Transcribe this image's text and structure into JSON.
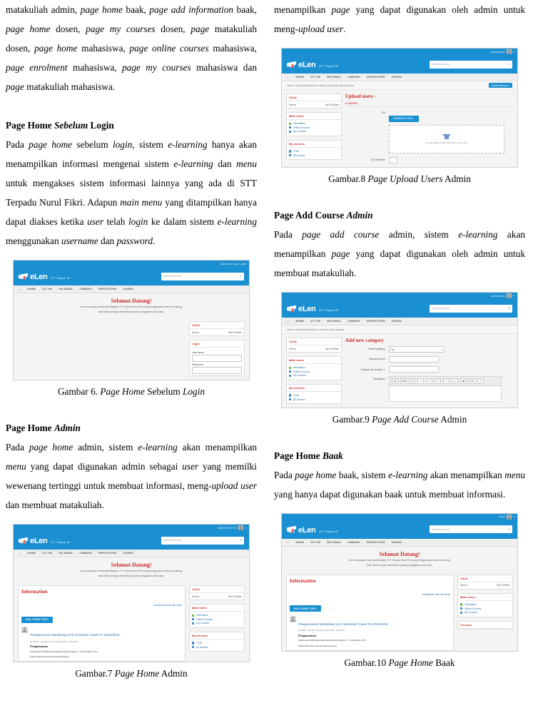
{
  "left_column": {
    "paragraph_top": {
      "runs": [
        {
          "t": "matakuliah admin, ",
          "i": false
        },
        {
          "t": "page home",
          "i": true
        },
        {
          "t": " baak, ",
          "i": false
        },
        {
          "t": "page add information",
          "i": true
        },
        {
          "t": " baak, ",
          "i": false
        },
        {
          "t": "page home",
          "i": true
        },
        {
          "t": " dosen, ",
          "i": false
        },
        {
          "t": "page my courses",
          "i": true
        },
        {
          "t": " dosen, ",
          "i": false
        },
        {
          "t": "page",
          "i": true
        },
        {
          "t": " matakuliah dosen, ",
          "i": false
        },
        {
          "t": "page home",
          "i": true
        },
        {
          "t": " mahasiswa, ",
          "i": false
        },
        {
          "t": "page online courses",
          "i": true
        },
        {
          "t": " mahasiswa, ",
          "i": false
        },
        {
          "t": "page enrolment",
          "i": true
        },
        {
          "t": " mahasiswa, ",
          "i": false
        },
        {
          "t": "page my courses",
          "i": true
        },
        {
          "t": " mahasiswa dan ",
          "i": false
        },
        {
          "t": "page",
          "i": true
        },
        {
          "t": " matakuliah mahasiswa.",
          "i": false
        }
      ]
    },
    "section1": {
      "heading_runs": [
        {
          "t": "Page Home ",
          "i": false
        },
        {
          "t": "Sebelum",
          "i": true
        },
        {
          "t": " Login",
          "i": false
        }
      ],
      "paragraph_runs": [
        {
          "t": "Pada ",
          "i": false
        },
        {
          "t": "page home",
          "i": true
        },
        {
          "t": " sebelum ",
          "i": false
        },
        {
          "t": "login",
          "i": true
        },
        {
          "t": ", sistem ",
          "i": false
        },
        {
          "t": "e-learning",
          "i": true
        },
        {
          "t": " hanya akan menampilkan informasi mengenai sistem ",
          "i": false
        },
        {
          "t": "e-learning",
          "i": true
        },
        {
          "t": " dan ",
          "i": false
        },
        {
          "t": "menu",
          "i": true
        },
        {
          "t": " untuk mengakses sistem informasi lainnya yang ada di STT Terpadu Nurul Fikri. Adapun ",
          "i": false
        },
        {
          "t": "main menu",
          "i": true
        },
        {
          "t": " yang ditampilkan hanya dapat diakses ketika ",
          "i": false
        },
        {
          "t": "user",
          "i": true
        },
        {
          "t": " telah ",
          "i": false
        },
        {
          "t": "login",
          "i": true
        },
        {
          "t": " ke dalam sistem ",
          "i": false
        },
        {
          "t": "e-learning",
          "i": true
        },
        {
          "t": " menggunakan ",
          "i": false
        },
        {
          "t": "username",
          "i": true
        },
        {
          "t": " dan ",
          "i": false
        },
        {
          "t": "password",
          "i": true
        },
        {
          "t": ".",
          "i": false
        }
      ],
      "caption_runs": [
        {
          "t": "Gambar 6. ",
          "i": false
        },
        {
          "t": "Page Home",
          "i": true
        },
        {
          "t": " Sebelum ",
          "i": false
        },
        {
          "t": "Login",
          "i": true
        }
      ]
    },
    "section2": {
      "heading_runs": [
        {
          "t": "Page Home ",
          "i": false
        },
        {
          "t": "Admin",
          "i": true
        }
      ],
      "paragraph_runs": [
        {
          "t": "Pada ",
          "i": false
        },
        {
          "t": "page home",
          "i": true
        },
        {
          "t": " admin, sistem ",
          "i": false
        },
        {
          "t": "e-learning",
          "i": true
        },
        {
          "t": " akan menampilkan ",
          "i": false
        },
        {
          "t": "menu",
          "i": true
        },
        {
          "t": " yang dapat digunakan admin sebagai ",
          "i": false
        },
        {
          "t": "user",
          "i": true
        },
        {
          "t": " yang memilki wewenang tertinggi untuk membuat informasi, meng-",
          "i": false
        },
        {
          "t": "upload user",
          "i": true
        },
        {
          "t": " dan membuat matakuliah.",
          "i": false
        }
      ],
      "caption_runs": [
        {
          "t": "Gambar.7 ",
          "i": false
        },
        {
          "t": "Page Home",
          "i": true
        },
        {
          "t": " Admin",
          "i": false
        }
      ]
    }
  },
  "right_column": {
    "paragraph_top": {
      "runs": [
        {
          "t": "menampilkan ",
          "i": false
        },
        {
          "t": "page",
          "i": true
        },
        {
          "t": " yang dapat digunakan oleh admin untuk meng-",
          "i": false
        },
        {
          "t": "upload user",
          "i": true
        },
        {
          "t": ".",
          "i": false
        }
      ]
    },
    "section3": {
      "caption_runs": [
        {
          "t": "Gambar.8 ",
          "i": false
        },
        {
          "t": "Page Upload Users",
          "i": true
        },
        {
          "t": " Admin",
          "i": false
        }
      ]
    },
    "section4": {
      "heading_runs": [
        {
          "t": "Page Add Course ",
          "i": false
        },
        {
          "t": "Admin",
          "i": true
        }
      ],
      "paragraph_runs": [
        {
          "t": "Pada ",
          "i": false
        },
        {
          "t": "page add course",
          "i": true
        },
        {
          "t": " admin, sistem ",
          "i": false
        },
        {
          "t": "e-learning",
          "i": true
        },
        {
          "t": " akan menampilkan ",
          "i": false
        },
        {
          "t": "page",
          "i": true
        },
        {
          "t": " yang dapat digunakan oleh admin untuk membuat matakuliah.",
          "i": false
        }
      ],
      "caption_runs": [
        {
          "t": "Gambar.9 ",
          "i": false
        },
        {
          "t": "Page Add Course",
          "i": true
        },
        {
          "t": " Admin",
          "i": false
        }
      ]
    },
    "section5": {
      "heading_runs": [
        {
          "t": "Page Home ",
          "i": false
        },
        {
          "t": "Baak",
          "i": true
        }
      ],
      "paragraph_runs": [
        {
          "t": "Pada ",
          "i": false
        },
        {
          "t": "page home",
          "i": true
        },
        {
          "t": " baak, sistem ",
          "i": false
        },
        {
          "t": "e-learning",
          "i": true
        },
        {
          "t": " akan menampilkan ",
          "i": false
        },
        {
          "t": "menu",
          "i": true
        },
        {
          "t": " yang hanya dapat digunakan baak untuk membuat informasi.",
          "i": false
        }
      ],
      "caption_runs": [
        {
          "t": "Gambar.10 ",
          "i": false
        },
        {
          "t": "Page Home",
          "i": true
        },
        {
          "t": " Baak"
        }
      ]
    }
  },
  "screenshots": {
    "common": {
      "brand_name": "eLen",
      "brand_tagline": "STT Terpadu NF",
      "nav_items": [
        "HOME",
        "STT NF",
        "SIS EMAIL",
        "LIBRARY",
        "REPOSITORY",
        "DOSEN"
      ],
      "home_icon": "home-icon",
      "search_placeholder": "Search courses",
      "search_icon": "search-icon",
      "welcome_title": "Selamat Datang!",
      "welcome_sub_line1": "eLen merupakan media pembelajaran STT Terpadu Nurul Fikri yang menggunakan sistem e-learning,",
      "welcome_sub_line2": "hadir dalam rangka memberikan layanan pengajaran untuk anda.",
      "colors": {
        "brand_blue": "#1a8fd1",
        "heading_red": "#cc2a2a",
        "link_blue": "#2b6fa8",
        "page_grey": "#f4f4f4"
      }
    },
    "fig6": {
      "top_right_text": "Anda belum login",
      "top_right_link": "Login",
      "blocks": [
        {
          "title": "Clock",
          "icons": "▫▫",
          "rows": [
            {
              "label": "Server",
              "value": "Sat 10:50am"
            }
          ]
        },
        {
          "title": "Login",
          "icons": "▫▫",
          "fields": [
            {
              "label": "Username",
              "value": ""
            },
            {
              "label": "Password",
              "value": ""
            }
          ]
        }
      ]
    },
    "fig7": {
      "user_label": "ADMINISTRATOR",
      "avatar": "avatar",
      "main_panel_title": "Information",
      "subscribe_link": "unsubscribe from this forum",
      "add_topic_button": "ADD A NEW TOPIC",
      "topic_title": "Pengumuman Menjelang UAS Semester Gasal TA 2015/2016",
      "topic_meta": "by Admin - Sunday, 29 November 2015, 11:33 AM",
      "topic_subheading": "Pengumuman",
      "topic_body_line1": "Pelaksanaan Bimbingan Akademik dimulai tanggal 9 - 23 Desember 2015.",
      "topic_body_line2": "Silakan hubungi dosen PA masing-masing.",
      "blocks": [
        {
          "title": "Clock",
          "icons": "▫▫",
          "rows": [
            {
              "label": "Server",
              "value": "Sat 10:50am"
            }
          ]
        },
        {
          "title": "Main menu",
          "icons": "▫▫",
          "items": [
            "Information",
            "Online Courses",
            "My Courses"
          ]
        },
        {
          "title": "My courses",
          "icons": "▫▫",
          "items": [
            "TI-5A",
            "All courses"
          ]
        }
      ]
    },
    "fig8": {
      "user_label": "Administrator",
      "breadcrumb": "Home ▸ Site administration ▸ Users ▸ Accounts ▸ Upload users",
      "blocks_editing_button": "Blocks editing on",
      "page_title": "Upload users",
      "page_title_help": "?",
      "section_label": "▸ Upload",
      "file_label": "File",
      "choose_file_button": "CHOOSE A FILE...",
      "dropzone_text": "You can drag and drop files here to add them.",
      "delimiter_label": "CSV delimiter",
      "delimiter_value": ",",
      "blocks": [
        {
          "title": "Clock",
          "icons": "▫▫",
          "rows": [
            {
              "label": "Server",
              "value": "Sat 10:50am"
            }
          ]
        },
        {
          "title": "Main menu",
          "icons": "▫▫",
          "items": [
            "Information",
            "Online Courses",
            "My Courses"
          ]
        },
        {
          "title": "My courses",
          "icons": "▫▫",
          "items": [
            "TI-5A",
            "All courses"
          ]
        }
      ]
    },
    "fig9": {
      "user_label": "Administrator",
      "breadcrumb": "Home ▸ Site administration ▸ Courses ▸ Add category",
      "page_title": "Add new category",
      "fields": [
        {
          "label": "Parent category",
          "type": "select",
          "value": "Top"
        },
        {
          "label": "Category name",
          "type": "input",
          "value": ""
        },
        {
          "label": "Category ID number ⓘ",
          "type": "input",
          "value": ""
        },
        {
          "label": "Description",
          "type": "editor",
          "value": ""
        }
      ],
      "editor_buttons": [
        "▤",
        "Aa▾",
        "B",
        "I",
        "≡",
        "≔",
        "↗",
        "↙",
        "▣",
        "H1",
        "❝"
      ],
      "blocks": [
        {
          "title": "Clock",
          "icons": "▫▫",
          "rows": [
            {
              "label": "Server",
              "value": "Sat 10:50am"
            }
          ]
        },
        {
          "title": "Main menu",
          "icons": "▫▫",
          "items": [
            "Information",
            "Online Courses",
            "My Courses"
          ]
        },
        {
          "title": "My courses",
          "icons": "▫▫",
          "items": [
            "TI-5A",
            "All courses"
          ]
        }
      ]
    },
    "fig10": {
      "user_label": "BAAK",
      "main_panel_title": "Information",
      "subscribe_link": "unsubscribe from this forum",
      "add_topic_button": "ADD A NEW TOPIC",
      "topic_title": "Pengumuman Menjelang UAS Semester Gasal TA 2015/2016",
      "topic_meta": "by Baak - Sunday, 29 November 2015, 11:33 AM",
      "topic_subheading": "Pengumuman",
      "topic_body_line1": "Pelaksanaan Bimbingan Akademik dimulai tanggal 9 - 23 Desember 2015.",
      "topic_body_line2": "Silakan hubungi dosen PA masing-masing.",
      "blocks": [
        {
          "title": "Clock",
          "icons": "▫▫",
          "rows": [
            {
              "label": "Server",
              "value": "Sat 10:50am"
            }
          ]
        },
        {
          "title": "Main menu",
          "icons": "▫▫",
          "items": [
            "Information",
            "Online Courses",
            "My Courses"
          ]
        },
        {
          "title": "Courses",
          "icons": "▫▫",
          "items": []
        }
      ]
    }
  }
}
